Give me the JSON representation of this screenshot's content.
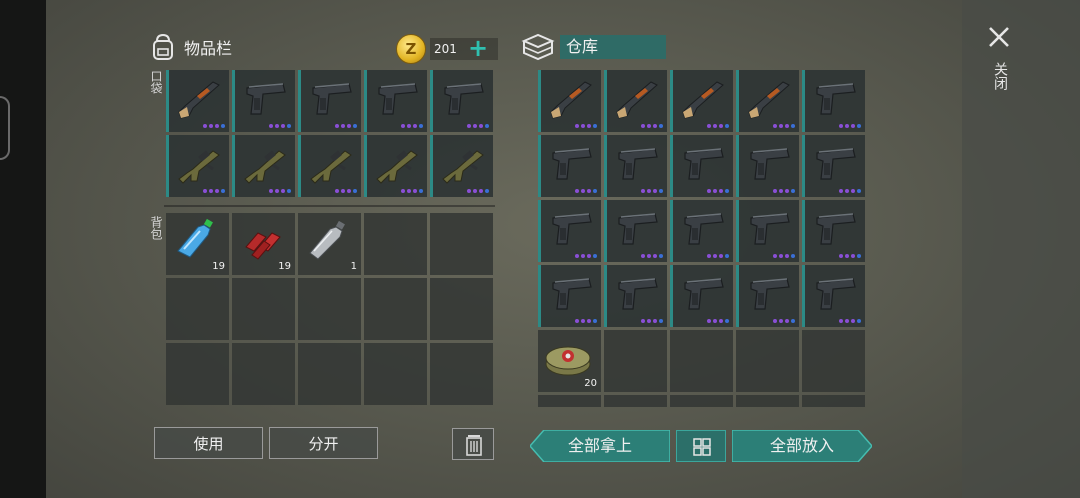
{
  "inventory": {
    "title": "物品栏",
    "coins": "201",
    "pocket_label": "口袋",
    "backpack_label": "背包",
    "pocket_items": [
      {
        "icon": "shotgun-icon"
      },
      {
        "icon": "pistol-icon"
      },
      {
        "icon": "pistol-icon"
      },
      {
        "icon": "pistol-icon"
      },
      {
        "icon": "pistol-icon"
      },
      {
        "icon": "smg-icon"
      },
      {
        "icon": "smg-icon"
      },
      {
        "icon": "smg-icon"
      },
      {
        "icon": "smg-icon"
      },
      {
        "icon": "smg-icon"
      }
    ],
    "backpack_items": [
      {
        "icon": "water-bottle-icon",
        "count": "19"
      },
      {
        "icon": "meat-icon",
        "count": "19"
      },
      {
        "icon": "empty-bottle-icon",
        "count": "1"
      }
    ]
  },
  "warehouse": {
    "title": "仓库",
    "items": [
      {
        "icon": "shotgun-icon"
      },
      {
        "icon": "shotgun-icon"
      },
      {
        "icon": "shotgun-icon"
      },
      {
        "icon": "shotgun-icon"
      },
      {
        "icon": "pistol-icon"
      },
      {
        "icon": "pistol-icon"
      },
      {
        "icon": "pistol-icon"
      },
      {
        "icon": "pistol-icon"
      },
      {
        "icon": "pistol-icon"
      },
      {
        "icon": "pistol-icon"
      },
      {
        "icon": "pistol-icon"
      },
      {
        "icon": "pistol-icon"
      },
      {
        "icon": "pistol-icon"
      },
      {
        "icon": "pistol-icon"
      },
      {
        "icon": "pistol-icon"
      },
      {
        "icon": "pistol-icon"
      },
      {
        "icon": "pistol-icon"
      },
      {
        "icon": "pistol-icon"
      },
      {
        "icon": "pistol-icon"
      },
      {
        "icon": "pistol-icon"
      },
      {
        "icon": "landmine-icon",
        "count": "20"
      }
    ]
  },
  "buttons": {
    "use": "使用",
    "split": "分开",
    "take_all": "全部拿上",
    "put_all": "全部放入",
    "close": "关闭"
  },
  "colors": {
    "accent": "#2c8a86",
    "dot_purple": "#8a4fd6",
    "dot_blue": "#3a6fd6"
  }
}
